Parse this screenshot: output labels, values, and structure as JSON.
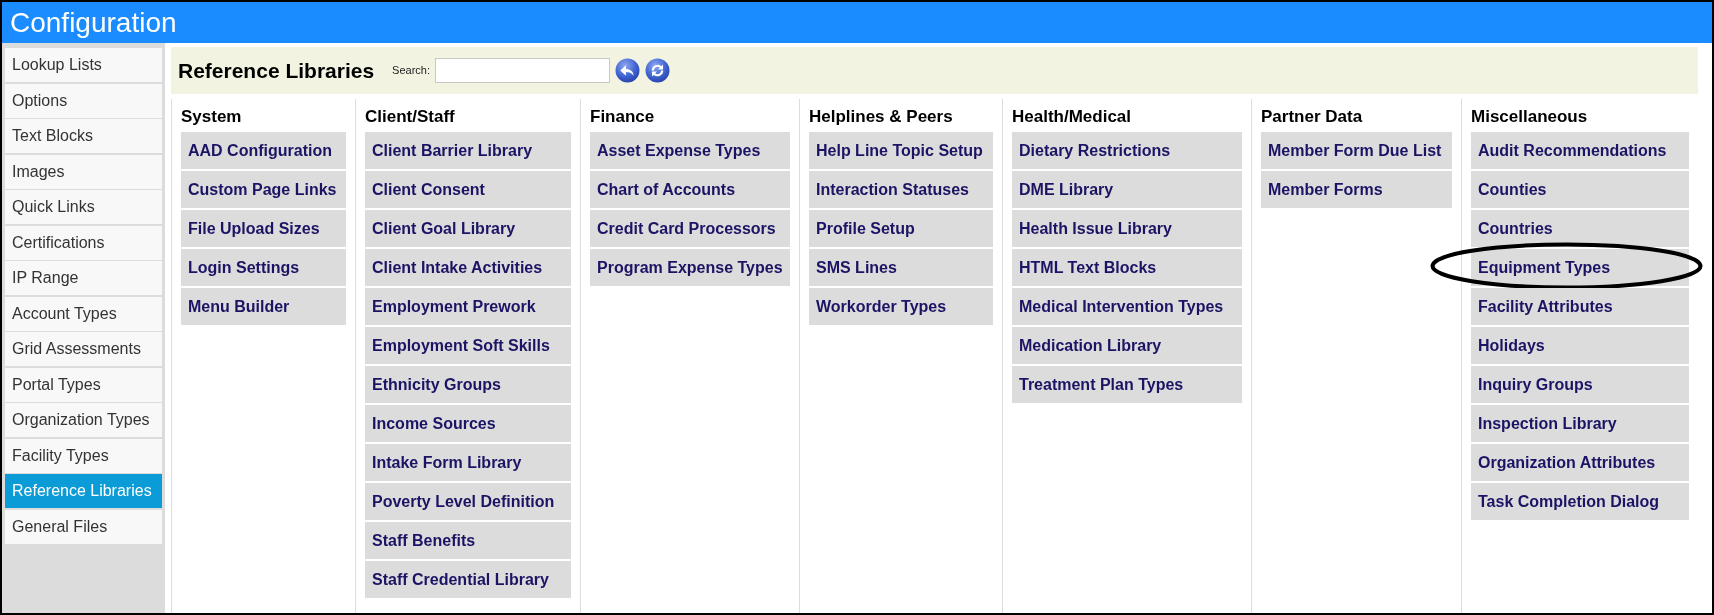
{
  "window": {
    "title": "Configuration"
  },
  "sidebar": {
    "items": [
      {
        "label": "Lookup Lists",
        "selected": false
      },
      {
        "label": "Options",
        "selected": false
      },
      {
        "label": "Text Blocks",
        "selected": false
      },
      {
        "label": "Images",
        "selected": false
      },
      {
        "label": "Quick Links",
        "selected": false
      },
      {
        "label": "Certifications",
        "selected": false
      },
      {
        "label": "IP Range",
        "selected": false
      },
      {
        "label": "Account Types",
        "selected": false
      },
      {
        "label": "Grid Assessments",
        "selected": false
      },
      {
        "label": "Portal Types",
        "selected": false
      },
      {
        "label": "Organization Types",
        "selected": false
      },
      {
        "label": "Facility Types",
        "selected": false
      },
      {
        "label": "Reference Libraries",
        "selected": true
      },
      {
        "label": "General Files",
        "selected": false
      }
    ]
  },
  "page": {
    "title": "Reference Libraries",
    "search": {
      "label": "Search:"
    }
  },
  "columns": [
    {
      "heading": "System",
      "items": [
        {
          "label": "AAD Configuration",
          "circled": false
        },
        {
          "label": "Custom Page Links",
          "circled": false
        },
        {
          "label": "File Upload Sizes",
          "circled": false
        },
        {
          "label": "Login Settings",
          "circled": false
        },
        {
          "label": "Menu Builder",
          "circled": false
        }
      ]
    },
    {
      "heading": "Client/Staff",
      "items": [
        {
          "label": "Client Barrier Library",
          "circled": false
        },
        {
          "label": "Client Consent",
          "circled": false
        },
        {
          "label": "Client Goal Library",
          "circled": false
        },
        {
          "label": "Client Intake Activities",
          "circled": false
        },
        {
          "label": "Employment Prework",
          "circled": false
        },
        {
          "label": "Employment Soft Skills",
          "circled": false
        },
        {
          "label": "Ethnicity Groups",
          "circled": false
        },
        {
          "label": "Income Sources",
          "circled": false
        },
        {
          "label": "Intake Form Library",
          "circled": false
        },
        {
          "label": "Poverty Level Definition",
          "circled": false
        },
        {
          "label": "Staff Benefits",
          "circled": false
        },
        {
          "label": "Staff Credential Library",
          "circled": false
        }
      ]
    },
    {
      "heading": "Finance",
      "items": [
        {
          "label": "Asset Expense Types",
          "circled": false
        },
        {
          "label": "Chart of Accounts",
          "circled": false
        },
        {
          "label": "Credit Card Processors",
          "circled": false
        },
        {
          "label": "Program Expense Types",
          "circled": false
        }
      ]
    },
    {
      "heading": "Helplines & Peers",
      "items": [
        {
          "label": "Help Line Topic Setup",
          "circled": false
        },
        {
          "label": "Interaction Statuses",
          "circled": false
        },
        {
          "label": "Profile Setup",
          "circled": false
        },
        {
          "label": "SMS Lines",
          "circled": false
        },
        {
          "label": "Workorder Types",
          "circled": false
        }
      ]
    },
    {
      "heading": "Health/Medical",
      "items": [
        {
          "label": "Dietary Restrictions",
          "circled": false
        },
        {
          "label": "DME Library",
          "circled": false
        },
        {
          "label": "Health Issue Library",
          "circled": false
        },
        {
          "label": "HTML Text Blocks",
          "circled": false
        },
        {
          "label": "Medical Intervention Types",
          "circled": false
        },
        {
          "label": "Medication Library",
          "circled": false
        },
        {
          "label": "Treatment Plan Types",
          "circled": false
        }
      ]
    },
    {
      "heading": "Partner Data",
      "items": [
        {
          "label": "Member Form Due List",
          "circled": false
        },
        {
          "label": "Member Forms",
          "circled": false
        }
      ]
    },
    {
      "heading": "Miscellaneous",
      "items": [
        {
          "label": "Audit Recommendations",
          "circled": false
        },
        {
          "label": "Counties",
          "circled": false
        },
        {
          "label": "Countries",
          "circled": false
        },
        {
          "label": "Equipment Types",
          "circled": true
        },
        {
          "label": "Facility Attributes",
          "circled": false
        },
        {
          "label": "Holidays",
          "circled": false
        },
        {
          "label": "Inquiry Groups",
          "circled": false
        },
        {
          "label": "Inspection Library",
          "circled": false
        },
        {
          "label": "Organization Attributes",
          "circled": false
        },
        {
          "label": "Task Completion Dialog",
          "circled": false
        }
      ]
    }
  ]
}
